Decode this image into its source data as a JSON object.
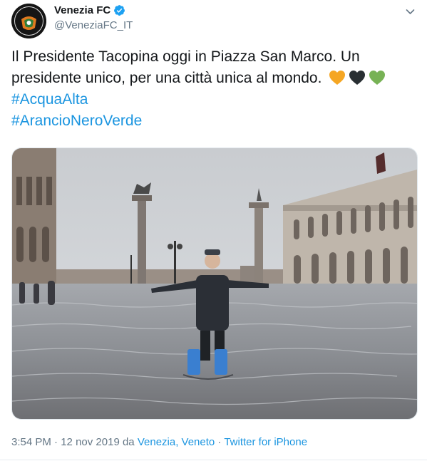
{
  "author": {
    "display_name": "Venezia FC",
    "handle": "@VeneziaFC_IT",
    "verified": true,
    "avatar_text": "VENEZIA"
  },
  "tweet": {
    "text_line1": "Il Presidente Tacopina oggi in Piazza San Marco. Un",
    "text_line2": "presidente unico, per una città unica al mondo.",
    "hashtags": [
      "#AcquaAlta",
      "#ArancioNeroVerde"
    ],
    "hearts": [
      {
        "icon": "orange-heart-icon",
        "color": "#f5a623"
      },
      {
        "icon": "black-heart-icon",
        "color": "#292f33"
      },
      {
        "icon": "green-heart-icon",
        "color": "#77b255"
      }
    ]
  },
  "meta": {
    "time": "3:54 PM",
    "sep1": " · ",
    "date": "12 nov 2019",
    "da": " da ",
    "location": "Venezia, Veneto",
    "sep2": " · ",
    "source": "Twitter for iPhone"
  },
  "colors": {
    "link": "#1b95e0",
    "secondary_text": "#657786",
    "verified": "#1da1f2"
  }
}
